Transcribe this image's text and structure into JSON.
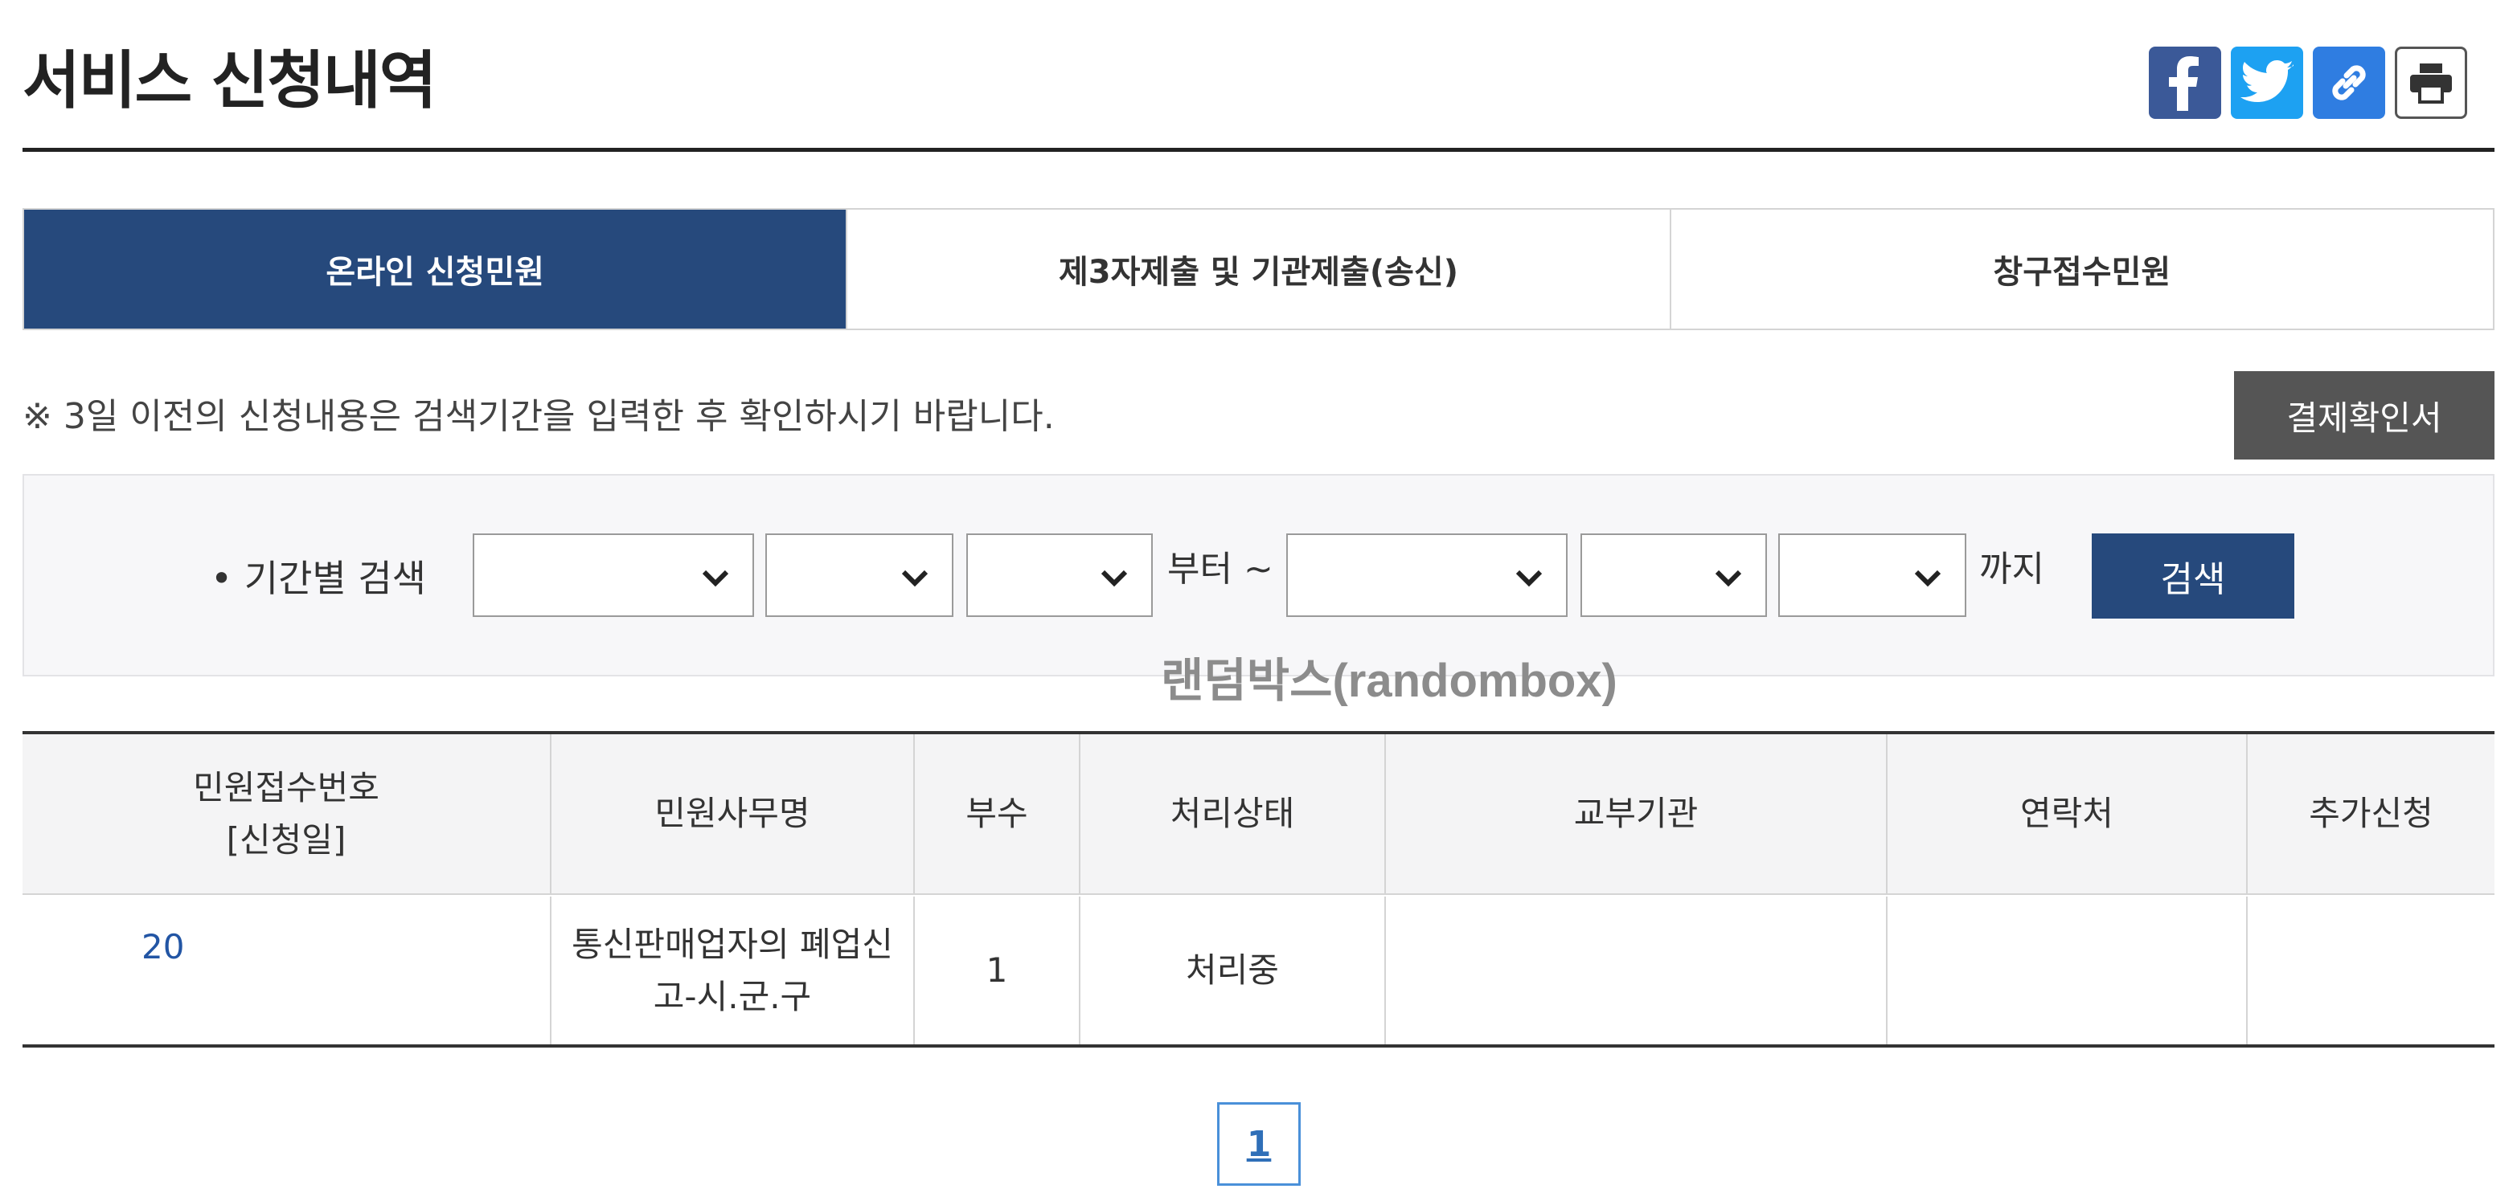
{
  "header": {
    "title": "서비스 신청내역"
  },
  "share": {
    "facebook": "facebook-icon",
    "twitter": "twitter-icon",
    "link": "link-icon",
    "print": "print-icon"
  },
  "tabs": [
    {
      "label": "온라인 신청민원",
      "active": true
    },
    {
      "label": "제3자제출 및 기관제출(송신)",
      "active": false
    },
    {
      "label": "창구접수민원",
      "active": false
    }
  ],
  "notice": "※ 3일 이전의 신청내용은 검색기간을 입력한 후 확인하시기 바랍니다.",
  "receipt_button": "결제확인서",
  "search": {
    "label": "• 기간별 검색",
    "from_suffix": "부터 ~",
    "to_suffix": "까지",
    "button": "검색",
    "selects": [
      "",
      "",
      "",
      "",
      "",
      ""
    ]
  },
  "watermark": "랜덤박스(randombox)",
  "table": {
    "headers": [
      "민원접수번호\n[신청일]",
      "민원사무명",
      "부수",
      "처리상태",
      "교부기관",
      "연락처",
      "추가신청"
    ],
    "rows": [
      {
        "no": "20",
        "name": "통신판매업자의 폐업신\n고-시.군.구",
        "copies": "1",
        "status": "처리중",
        "agency": "",
        "contact": "",
        "extra": ""
      }
    ]
  },
  "pagination": {
    "current": "1"
  },
  "colors": {
    "accent": "#26497c",
    "link": "#2255a4"
  }
}
